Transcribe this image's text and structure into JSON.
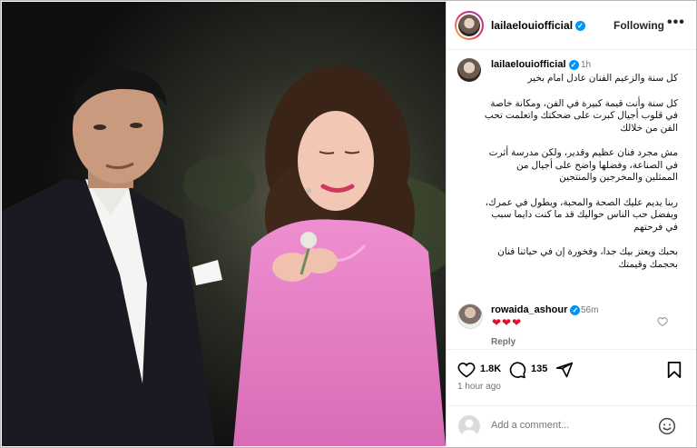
{
  "post": {
    "username": "lailaelouiofficial",
    "follow_state": "Following",
    "more_label": "•••",
    "caption_time": "1h",
    "caption_paragraphs": [
      "كل سنة والزعيم الفنان عادل امام بخير",
      "كل سنة وأنت قيمة كبيرة في الفن، ومكانة خاصة في قلوب أجيال كبرت على ضحكتك واتعلمت تحب الفن من خلالك",
      "مش مجرد فنان عظيم وقدير، ولكن مدرسة أثرت في الصناعة، وفضلها واضح على أجيال من الممثلين والمخرجين والمنتجين",
      "ربنا يديم عليك الصحة والمحبة، ويطول في عمرك، ويفضل حب الناس حواليك قد ما كنت دايما سبب في فرحتهم",
      "بحبك ويعتز بيك جدا، وفخورة إن في حياتنا فنان بحجمك وقيمتك"
    ]
  },
  "comment": {
    "username": "rowaida_ashour",
    "time": "56m",
    "text": "❤❤❤",
    "reply_label": "Reply"
  },
  "actions": {
    "likes": "1.8K",
    "comments": "135"
  },
  "posted_time": "1 hour ago",
  "add_comment": {
    "placeholder": "Add a comment..."
  },
  "colors": {
    "verified": "#0095f6",
    "heart": "#e0102c",
    "dress": "#e77fc4",
    "suit": "#1a1a22"
  },
  "icons": [
    "more-icon",
    "verified-icon",
    "heart-icon",
    "comment-icon",
    "share-icon",
    "bookmark-icon",
    "emoji-icon",
    "avatar-icon"
  ]
}
